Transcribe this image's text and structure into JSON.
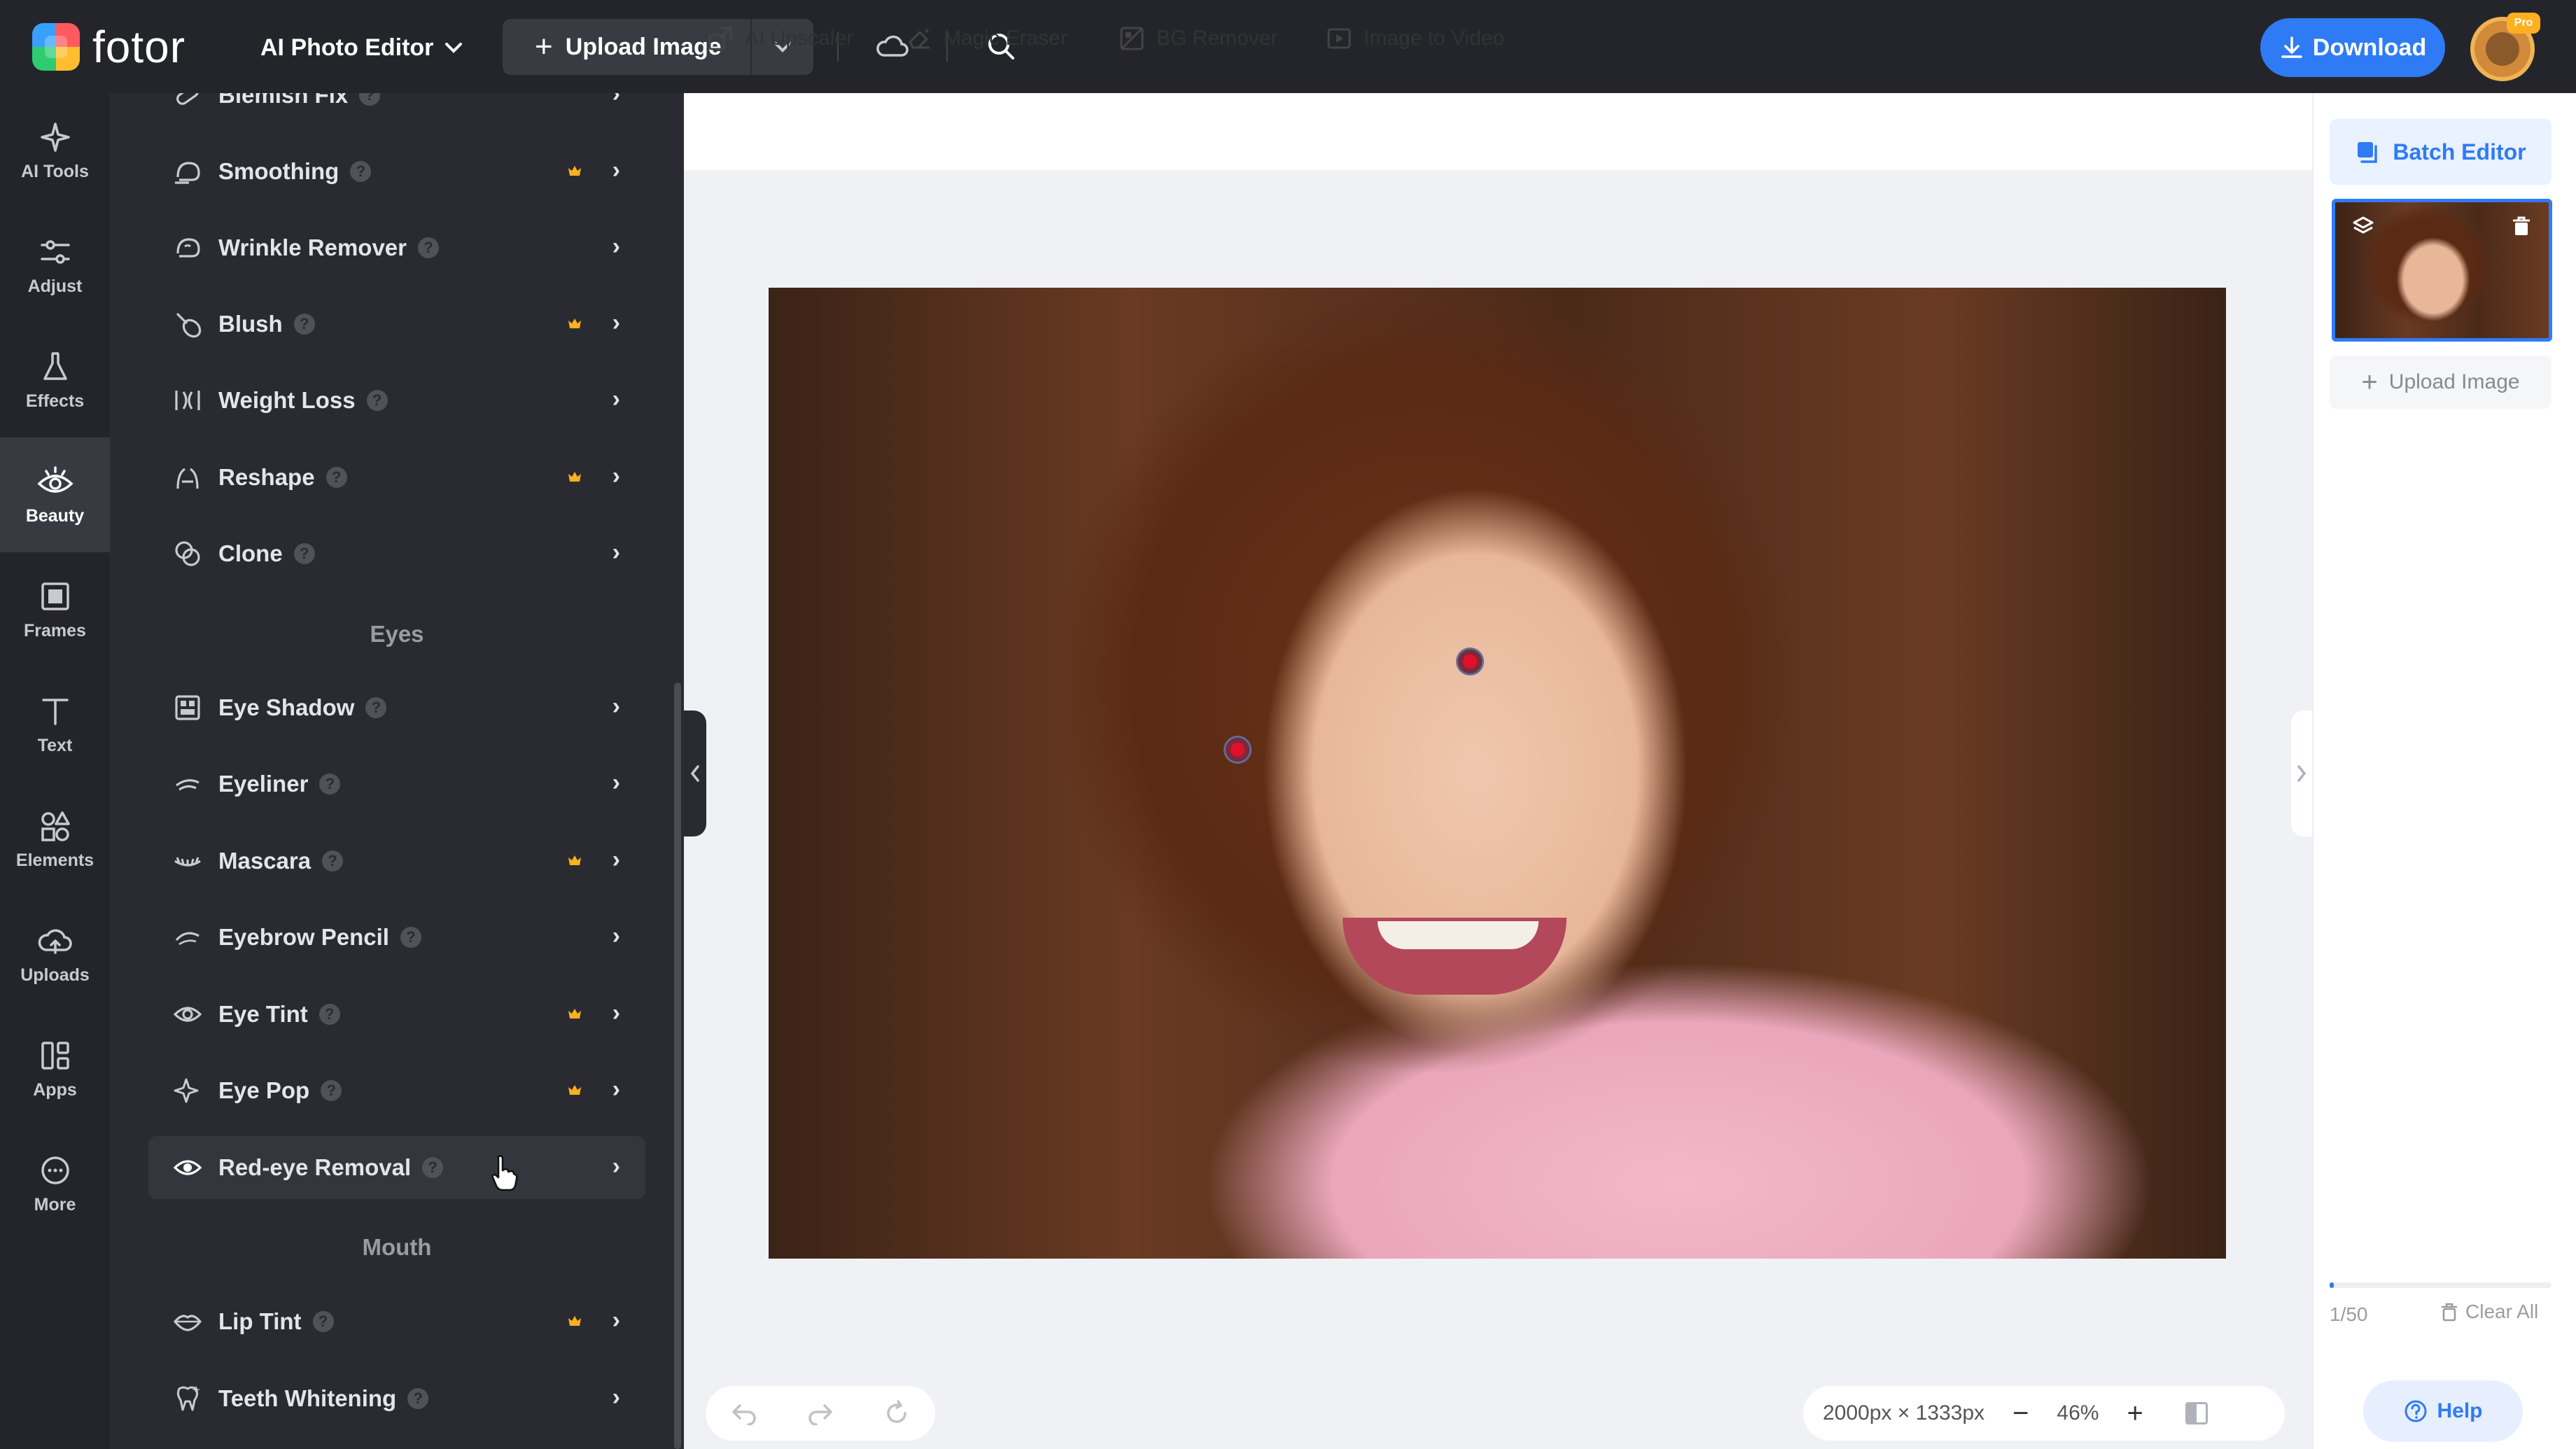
{
  "header": {
    "logo_text": "fotor",
    "editor_menu": "AI Photo Editor",
    "upload_label": "Upload Image",
    "download_label": "Download",
    "pro_badge": "Pro"
  },
  "leftnav": {
    "items": [
      {
        "label": "AI Tools",
        "icon": "sparkle-icon"
      },
      {
        "label": "Adjust",
        "icon": "sliders-icon"
      },
      {
        "label": "Effects",
        "icon": "flask-icon"
      },
      {
        "label": "Beauty",
        "icon": "eye-icon",
        "active": true
      },
      {
        "label": "Frames",
        "icon": "frame-icon"
      },
      {
        "label": "Text",
        "icon": "text-icon"
      },
      {
        "label": "Elements",
        "icon": "shapes-icon"
      },
      {
        "label": "Uploads",
        "icon": "cloud-upload-icon"
      },
      {
        "label": "Apps",
        "icon": "apps-icon"
      },
      {
        "label": "More",
        "icon": "more-icon"
      }
    ]
  },
  "tools": {
    "rows": [
      {
        "label": "Blemish Fix",
        "crown": false
      },
      {
        "label": "Smoothing",
        "crown": true
      },
      {
        "label": "Wrinkle Remover",
        "crown": false
      },
      {
        "label": "Blush",
        "crown": true
      },
      {
        "label": "Weight Loss",
        "crown": false
      },
      {
        "label": "Reshape",
        "crown": true
      },
      {
        "label": "Clone",
        "crown": false
      }
    ],
    "section_eyes": "Eyes",
    "eye_rows": [
      {
        "label": "Eye Shadow",
        "crown": false
      },
      {
        "label": "Eyeliner",
        "crown": false
      },
      {
        "label": "Mascara",
        "crown": true
      },
      {
        "label": "Eyebrow Pencil",
        "crown": false
      },
      {
        "label": "Eye Tint",
        "crown": true
      },
      {
        "label": "Eye Pop",
        "crown": true
      },
      {
        "label": "Red-eye Removal",
        "crown": false,
        "active": true
      }
    ],
    "section_mouth": "Mouth",
    "mouth_rows": [
      {
        "label": "Lip Tint",
        "crown": true
      },
      {
        "label": "Teeth Whitening",
        "crown": false
      }
    ],
    "help_glyph": "?",
    "chevron": "›"
  },
  "quickbar": {
    "items": [
      "AI Upscaler",
      "Magic Eraser",
      "BG Remover",
      "Image to Video"
    ]
  },
  "canvas": {
    "dimensions": "2000px × 1333px",
    "zoom": "46%",
    "zoom_out": "−",
    "zoom_in": "+"
  },
  "rightpanel": {
    "batch_label": "Batch Editor",
    "upload_label": "Upload Image",
    "count": "1/50",
    "progress": 0.02,
    "clear_label": "Clear All",
    "help_label": "Help"
  },
  "colors": {
    "accent": "#2f7bf5",
    "crown": "#ffb020",
    "dark_bg": "#24252b",
    "panel_bg": "#2a2b31"
  }
}
